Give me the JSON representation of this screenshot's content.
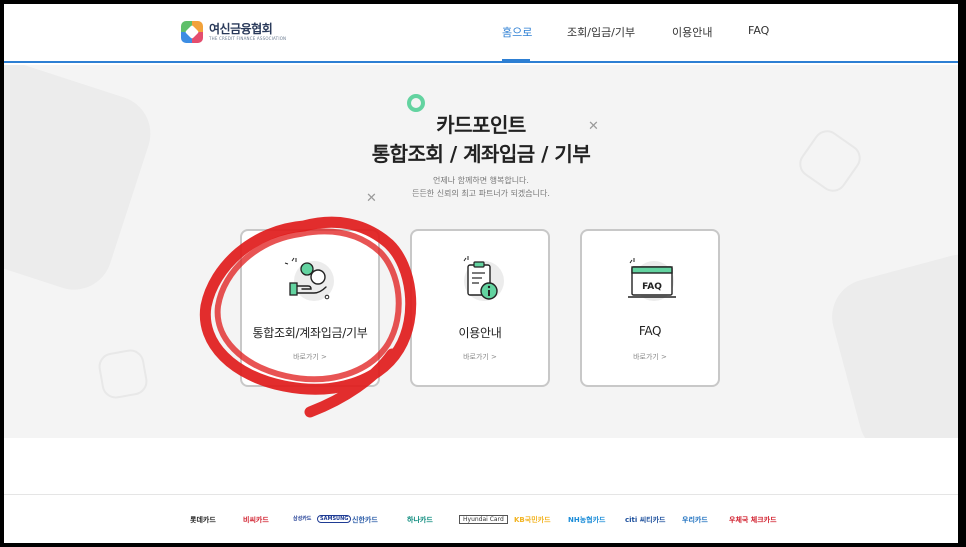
{
  "header": {
    "logo_name": "여신금융협회",
    "logo_sub": "THE CREDIT FINANCE ASSOCIATION",
    "nav": [
      {
        "label": "홈으로"
      },
      {
        "label": "조회/입금/기부"
      },
      {
        "label": "이용안내"
      },
      {
        "label": "FAQ"
      }
    ],
    "active_index": 0
  },
  "hero": {
    "title_line1": "카드포인트",
    "title_line2": "통합조회 / 계좌입금 / 기부",
    "subtitle_line1": "언제나 함께하면 행복합니다.",
    "subtitle_line2": "든든한 신뢰의 최고 파트너가 되겠습니다."
  },
  "cards": [
    {
      "title": "통합조회/계좌입금/기부",
      "link": "바로가기 >",
      "icon": "hand-coin-icon"
    },
    {
      "title": "이용안내",
      "link": "바로가기 >",
      "icon": "clipboard-info-icon"
    },
    {
      "title": "FAQ",
      "link": "바로가기 >",
      "icon": "faq-monitor-icon",
      "icon_text": "FAQ"
    }
  ],
  "footer": {
    "partners": [
      {
        "label": "롯데카드",
        "color": "#222222"
      },
      {
        "label": "비씨카드",
        "color": "#d11f2d"
      },
      {
        "label": "삼성카드",
        "color": "#1f3c94"
      },
      {
        "label": "SAMSUNG",
        "color": "#1f3c94"
      },
      {
        "label": "신한카드",
        "color": "#2b5ca8"
      },
      {
        "label": "하나카드",
        "color": "#0a8a7c"
      },
      {
        "label": "Hyundai Card",
        "color": "#333333"
      },
      {
        "label": "KB국민카드",
        "color": "#f2b320"
      },
      {
        "label": "NH농협카드",
        "color": "#1a8cd8"
      },
      {
        "label": "citi 씨티카드",
        "color": "#1c4f9c"
      },
      {
        "label": "우리카드",
        "color": "#1c6fbf"
      },
      {
        "label": "우체국 체크카드",
        "color": "#d11f2d"
      }
    ]
  },
  "colors": {
    "accent": "#2d7fd3",
    "ring": "#63d3a0",
    "annotation": "#e01b1b"
  }
}
